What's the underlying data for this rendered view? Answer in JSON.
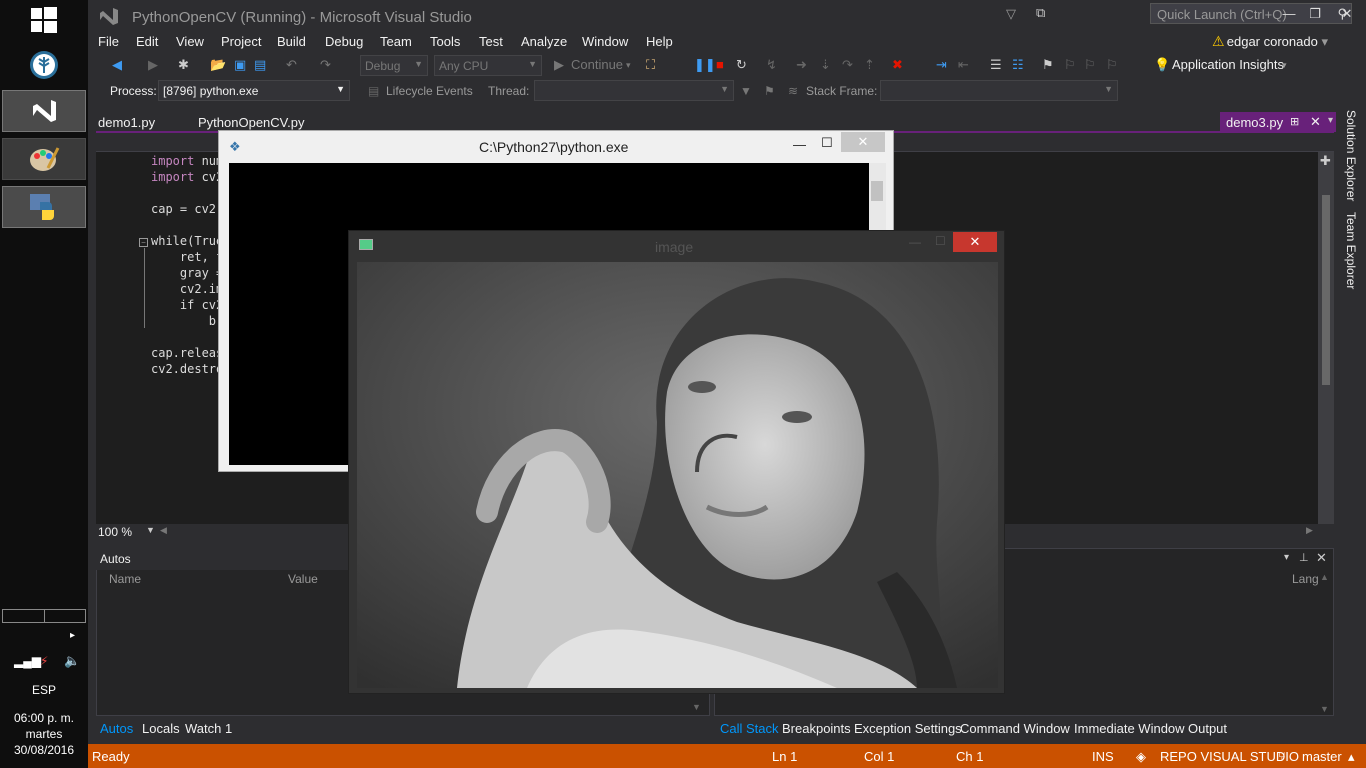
{
  "window": {
    "title": "PythonOpenCV (Running) - Microsoft Visual Studio",
    "quick_launch_placeholder": "Quick Launch (Ctrl+Q)",
    "user": "edgar coronado"
  },
  "menu": [
    "File",
    "Edit",
    "View",
    "Project",
    "Build",
    "Debug",
    "Team",
    "Tools",
    "Test",
    "Analyze",
    "Window",
    "Help"
  ],
  "toolbar": {
    "config": "Debug",
    "platform": "Any CPU",
    "continue": "Continue",
    "app_insights": "Application Insights"
  },
  "debug_toolbar": {
    "process_label": "Process:",
    "process_value": "[8796] python.exe",
    "lifecycle": "Lifecycle Events",
    "thread_label": "Thread:",
    "stack_label": "Stack Frame:"
  },
  "tabs": {
    "left": [
      "demo1.py",
      "PythonOpenCV.py"
    ],
    "active": "demo3.py"
  },
  "code_lines": [
    {
      "kw": "import",
      "rest": " num"
    },
    {
      "kw": "import",
      "rest": " cv2"
    },
    {
      "kw": "",
      "rest": "cap = cv2."
    },
    {
      "kw": "",
      "rest": "while(True"
    },
    {
      "kw": "",
      "rest": "    ret, f"
    },
    {
      "kw": "",
      "rest": "    gray ="
    },
    {
      "kw": "",
      "rest": "    cv2.im"
    },
    {
      "kw": "",
      "rest": "    if cv2"
    },
    {
      "kw": "",
      "rest": "        br"
    },
    {
      "kw": "",
      "rest": "cap.releas"
    },
    {
      "kw": "",
      "rest": "cv2.destro"
    }
  ],
  "zoom": "100 %",
  "side_tabs": [
    "Solution Explorer",
    "Team Explorer"
  ],
  "autos": {
    "title": "Autos",
    "col_name": "Name",
    "col_value": "Value"
  },
  "callstack": {
    "col_lang": "Lang"
  },
  "bottom_tabs_left": [
    "Autos",
    "Locals",
    "Watch 1"
  ],
  "bottom_tabs_right": [
    "Call Stack",
    "Breakpoints",
    "Exception Settings",
    "Command Window",
    "Immediate Window",
    "Output"
  ],
  "status": {
    "ready": "Ready",
    "ln": "Ln 1",
    "col": "Col 1",
    "ch": "Ch 1",
    "ins": "INS",
    "repo": "REPO VISUAL STUDIO",
    "branch": "master"
  },
  "console": {
    "title": "C:\\Python27\\python.exe"
  },
  "image_window": {
    "title": "image"
  },
  "taskbar": {
    "lang": "ESP",
    "time": "06:00 p. m.",
    "day": "martes",
    "date": "30/08/2016"
  },
  "colors": {
    "accent": "#68217a",
    "status": "#ca5100",
    "link": "#0097fb"
  }
}
